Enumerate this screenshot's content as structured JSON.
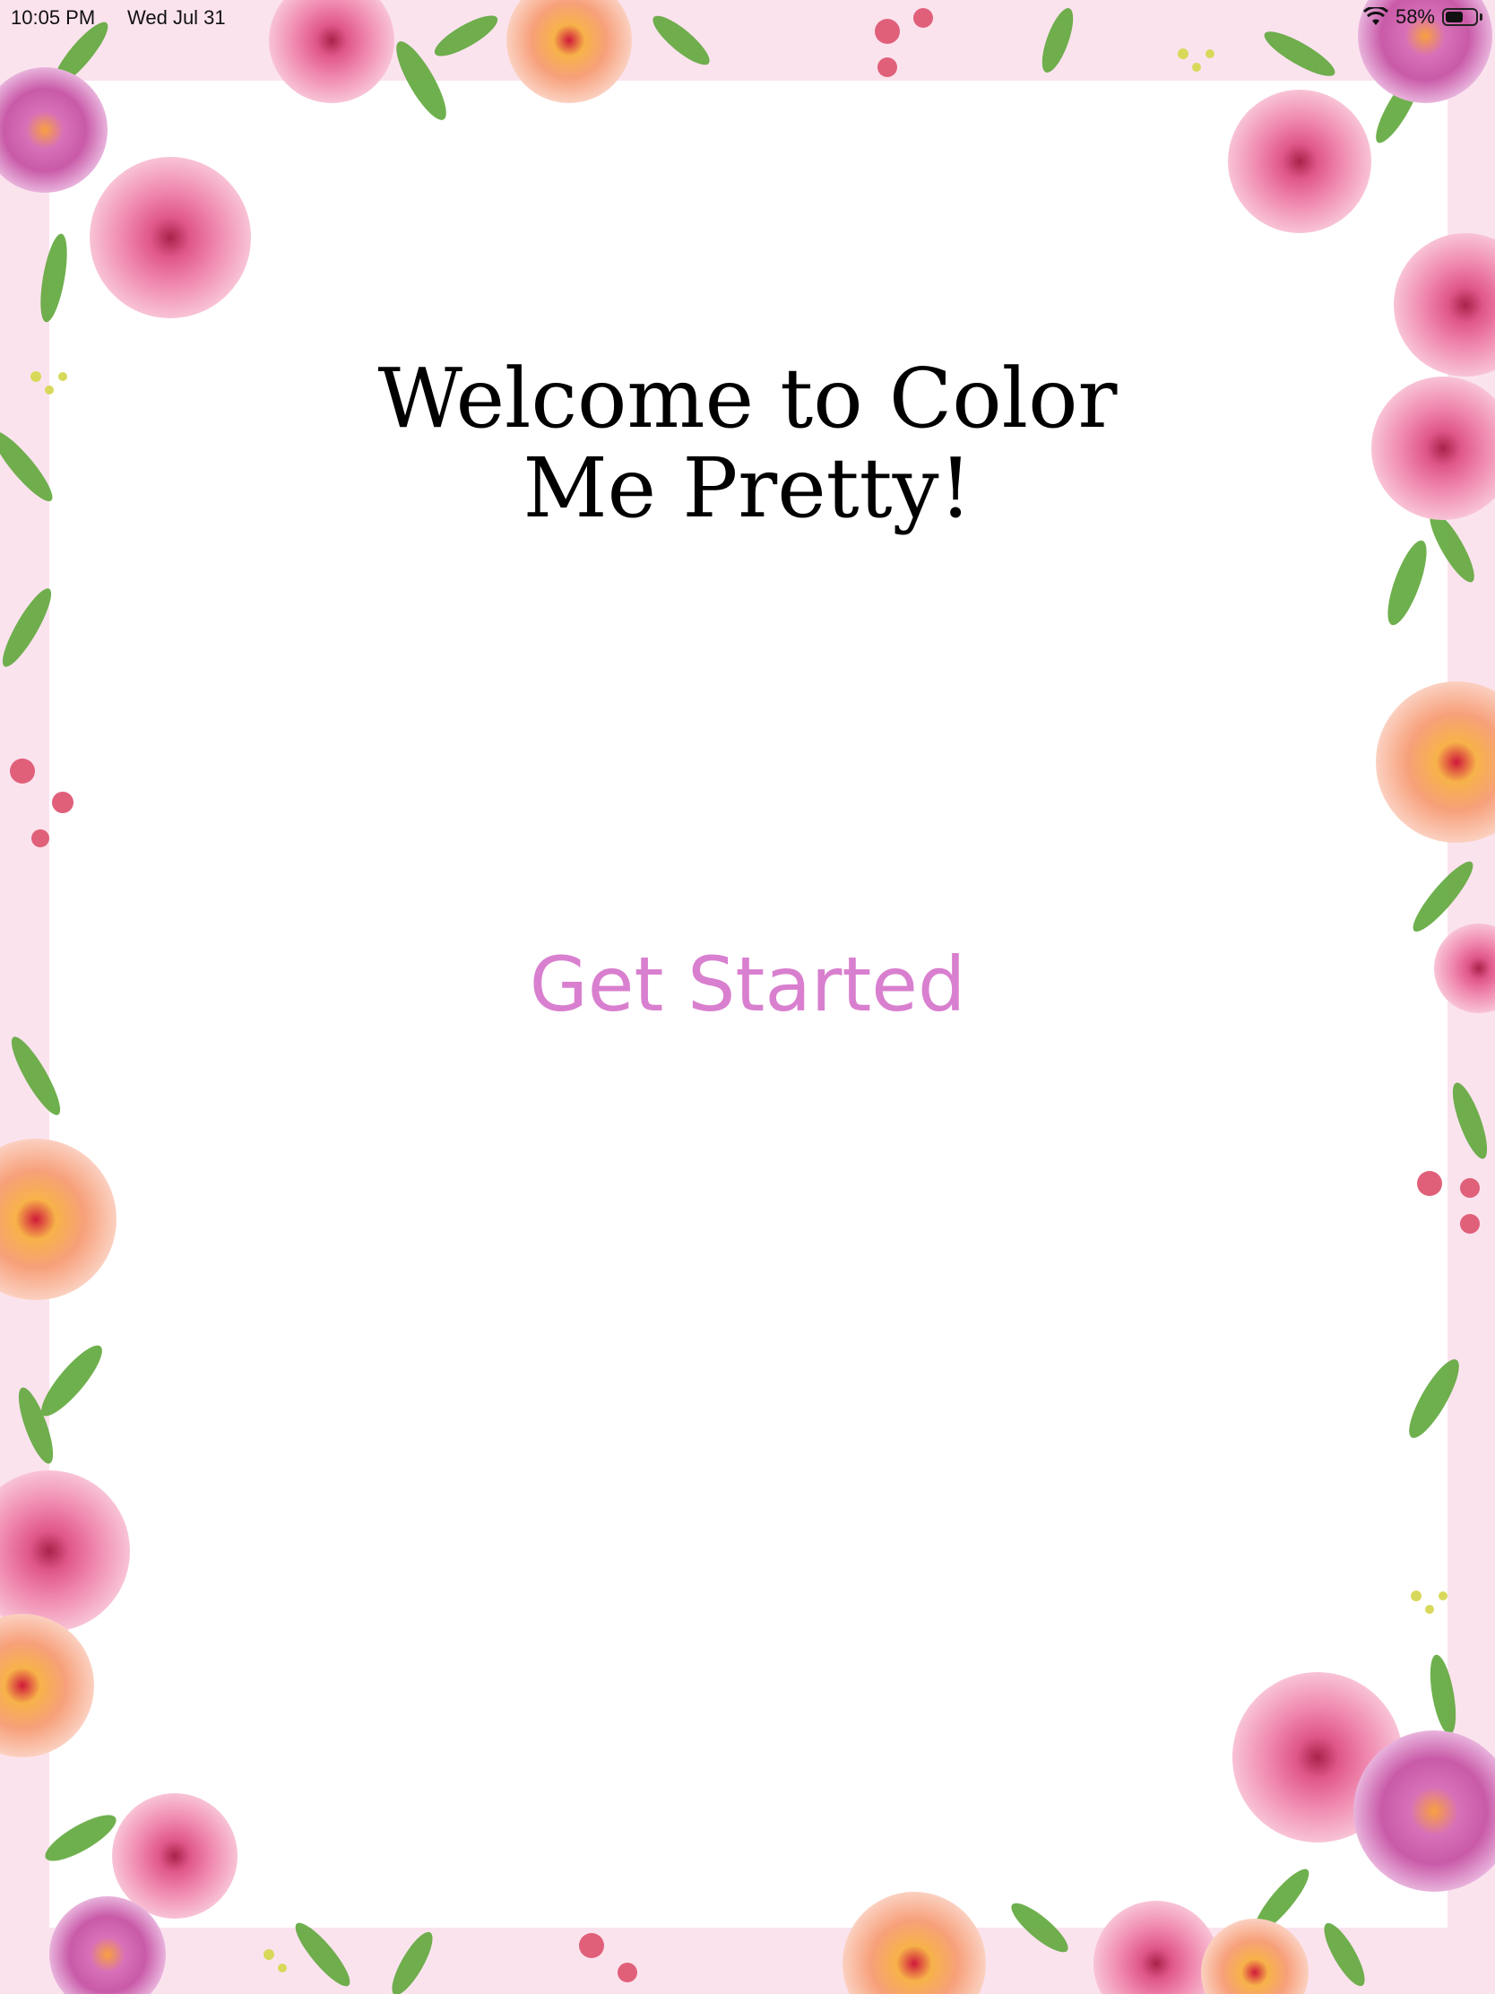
{
  "status_bar": {
    "time": "10:05 PM",
    "date": "Wed Jul 31",
    "battery_percent": "58%",
    "battery_level": 0.58,
    "icons": [
      "wifi-icon",
      "battery-icon"
    ]
  },
  "welcome": {
    "line1": "Welcome to Color",
    "line2": "Me Pretty!"
  },
  "get_started": {
    "label": "Get Started"
  },
  "colors": {
    "accent": "#d97fcf",
    "title_text": "#000000",
    "flower_pink": "#f08ab0",
    "flower_coral": "#f7a07a",
    "flower_orange": "#f7b24a",
    "flower_magenta": "#c95aa8",
    "leaf_green": "#5fa83a",
    "background": "#ffffff"
  }
}
